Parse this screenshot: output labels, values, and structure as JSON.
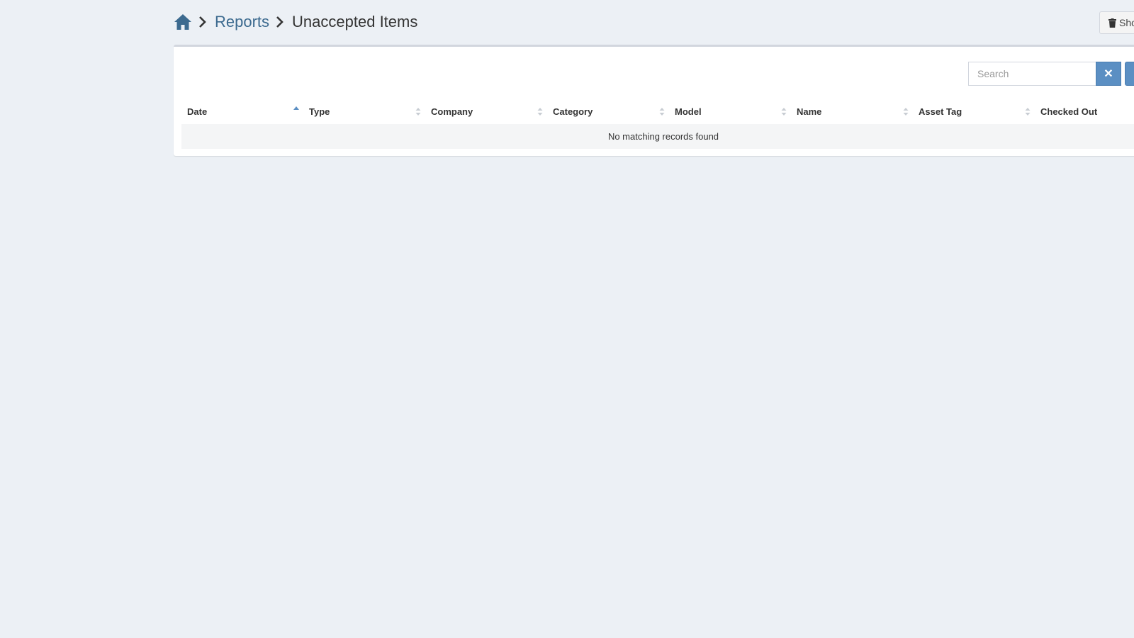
{
  "breadcrumb": {
    "home_icon": "home-icon",
    "reports_label": "Reports",
    "current_label": "Unaccepted Items"
  },
  "top_button": {
    "label": "Sho",
    "icon": "trash-icon"
  },
  "search": {
    "placeholder": "Search",
    "value": ""
  },
  "clear_button": {
    "label": "✕"
  },
  "table": {
    "columns": [
      {
        "label": "Date",
        "sorted": "asc"
      },
      {
        "label": "Type",
        "sorted": "none"
      },
      {
        "label": "Company",
        "sorted": "none"
      },
      {
        "label": "Category",
        "sorted": "none"
      },
      {
        "label": "Model",
        "sorted": "none"
      },
      {
        "label": "Name",
        "sorted": "none"
      },
      {
        "label": "Asset Tag",
        "sorted": "none"
      },
      {
        "label": "Checked Out",
        "sorted": "none"
      }
    ],
    "empty_message": "No matching records found"
  },
  "colors": {
    "background": "#ecf0f5",
    "link": "#3c6a8f",
    "button_primary": "#5b8fc3",
    "sort_active": "#5b8fc3",
    "sort_inactive": "#c8cdd3"
  }
}
